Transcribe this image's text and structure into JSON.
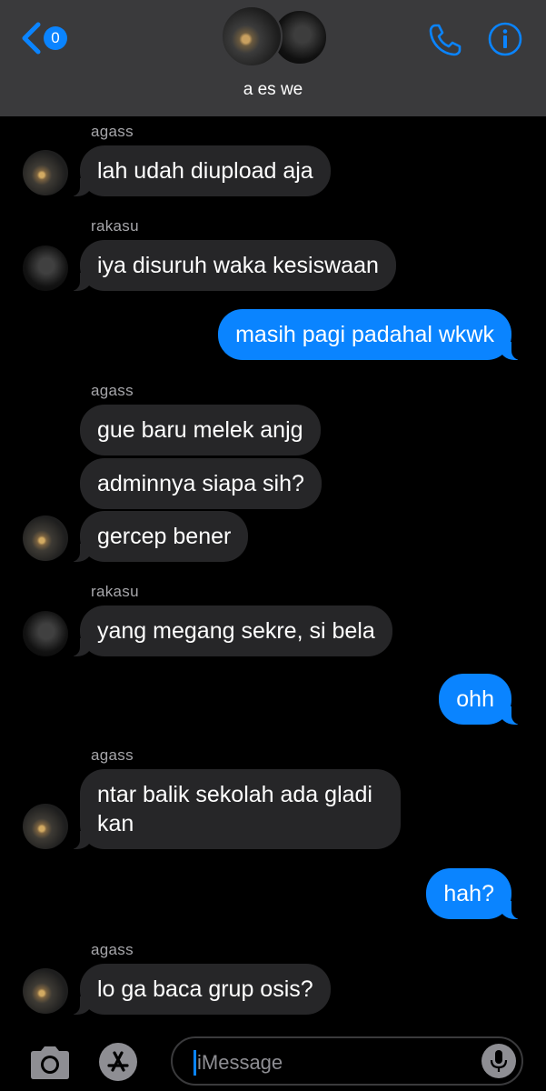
{
  "header": {
    "back_count": "0",
    "group_name": "a es we"
  },
  "colors": {
    "accent": "#0a84ff",
    "incoming_bubble": "#262628",
    "header_bg": "#3a3a3c"
  },
  "icons": {
    "back": "chevron-left-icon",
    "call": "phone-icon",
    "info": "info-icon",
    "camera": "camera-icon",
    "apps": "app-store-icon",
    "mic": "microphone-icon"
  },
  "messages": [
    {
      "sender": "agass",
      "text": "lah udah diupload aja"
    },
    {
      "sender": "rakasu",
      "text": "iya disuruh waka kesiswaan"
    },
    {
      "sender": "me",
      "text": "masih pagi padahal wkwk"
    },
    {
      "sender": "agass",
      "text": "gue baru melek anjg"
    },
    {
      "sender": "agass",
      "text": "adminnya siapa sih?"
    },
    {
      "sender": "agass",
      "text": "gercep bener"
    },
    {
      "sender": "rakasu",
      "text": "yang megang sekre, si bela"
    },
    {
      "sender": "me",
      "text": "ohh"
    },
    {
      "sender": "agass",
      "text": "ntar balik sekolah ada gladi kan"
    },
    {
      "sender": "me",
      "text": "hah?"
    },
    {
      "sender": "agass",
      "text": "lo ga baca grup osis?"
    }
  ],
  "input": {
    "placeholder": "iMessage"
  }
}
